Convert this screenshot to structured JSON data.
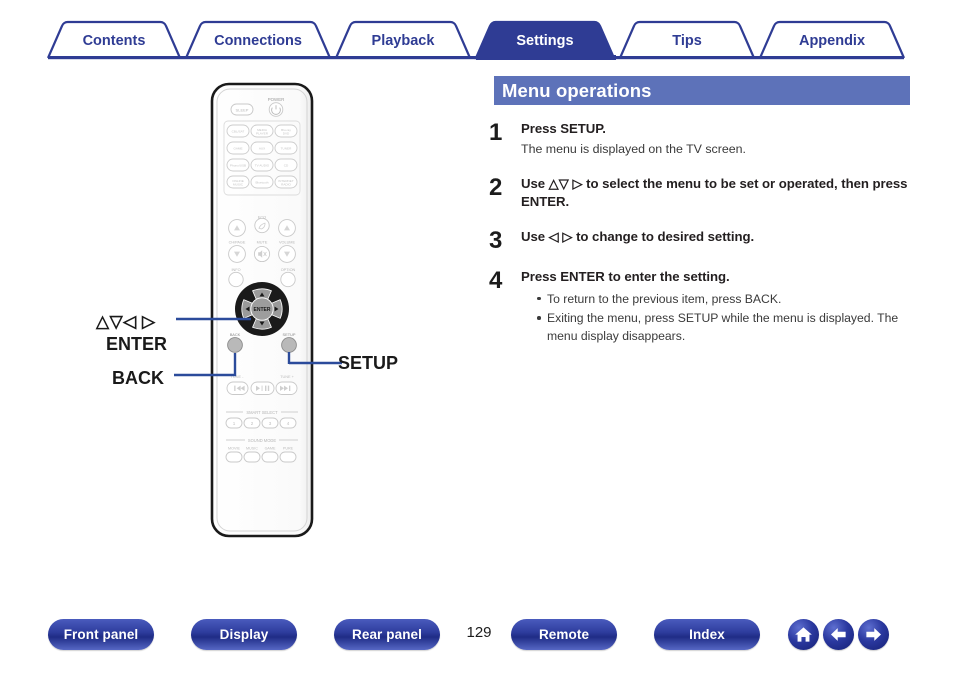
{
  "tabs": [
    {
      "label": "Contents",
      "active": false
    },
    {
      "label": "Connections",
      "active": false
    },
    {
      "label": "Playback",
      "active": false
    },
    {
      "label": "Settings",
      "active": true
    },
    {
      "label": "Tips",
      "active": false
    },
    {
      "label": "Appendix",
      "active": false
    }
  ],
  "section": {
    "heading": "Menu operations"
  },
  "steps": [
    {
      "number": "1",
      "title": "Press SETUP.",
      "desc": "The menu is displayed on the TV screen."
    },
    {
      "number": "2",
      "title": "Use △▽ ▷ to select the menu to be set or operated, then press ENTER."
    },
    {
      "number": "3",
      "title": "Use ◁ ▷ to change to desired setting."
    },
    {
      "number": "4",
      "title": "Press ENTER to enter the setting.",
      "bullets": [
        "To return to the previous item, press BACK.",
        "Exiting the menu, press SETUP while the menu is displayed. The menu display disappears."
      ]
    }
  ],
  "callouts": [
    {
      "label": "△▽◁ ▷",
      "name": "cursor-arrows"
    },
    {
      "label": "ENTER",
      "name": "enter"
    },
    {
      "label": "BACK",
      "name": "back"
    },
    {
      "label": "SETUP",
      "name": "setup"
    }
  ],
  "remote": {
    "power_label": "POWER",
    "sleep_label": "SLEEP",
    "power_icon": "power-symbol",
    "sources": [
      "CBL/SAT",
      "MEDIA PLAYER",
      "Blu-ray DVD",
      "GAME",
      "AUX",
      "TUNER",
      "Phono/USB",
      "TV AUDIO",
      "CD",
      "ONLINE MUSIC",
      "Bluetooth",
      "INTERNET RADIO"
    ],
    "ecolabel": "ECO",
    "chpage_label": "CH/PAGE",
    "mute_label": "MUTE",
    "volume_label": "VOLUME",
    "info_label": "INFO",
    "option_label": "OPTION",
    "enter_label": "ENTER",
    "back_label": "BACK",
    "setup_label": "SETUP",
    "tune_minus_label": "TUNE -",
    "tune_plus_label": "TUNE +",
    "smart_select_label": "SMART SELECT",
    "smart_select_numbers": [
      "1",
      "2",
      "3",
      "4"
    ],
    "sound_mode_label": "SOUND MODE",
    "sound_modes": [
      "MOVIE",
      "MUSIC",
      "GAME",
      "PURE"
    ]
  },
  "bottom_nav": {
    "buttons": [
      {
        "label": "Front panel",
        "name": "front-panel"
      },
      {
        "label": "Display",
        "name": "display"
      },
      {
        "label": "Rear panel",
        "name": "rear-panel"
      },
      {
        "label": "Remote",
        "name": "remote"
      },
      {
        "label": "Index",
        "name": "index"
      }
    ],
    "page_number": "129",
    "icons": [
      {
        "name": "home-icon"
      },
      {
        "name": "arrow-left-icon"
      },
      {
        "name": "arrow-right-icon"
      }
    ]
  },
  "colors": {
    "tab_blue": "#2f3c94",
    "heading_blue": "#5d72b9",
    "callout_line": "#2b4b9b"
  }
}
